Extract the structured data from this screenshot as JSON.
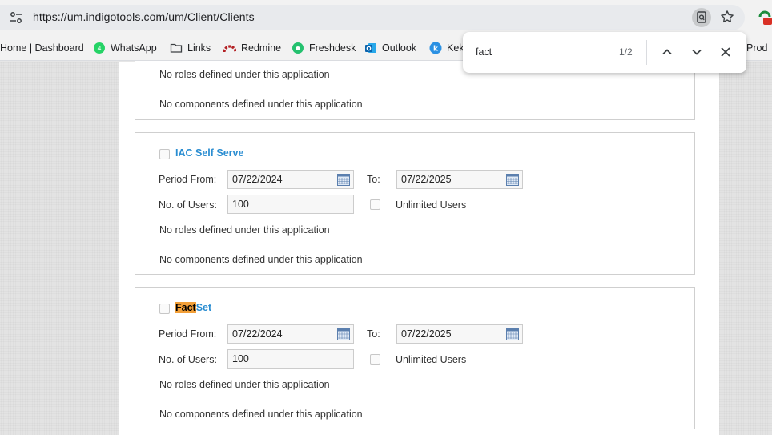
{
  "browser": {
    "url": "https://um.indigotools.com/um/Client/Clients",
    "bookmarks": [
      {
        "label": "Home | Dashboard"
      },
      {
        "label": "WhatsApp"
      },
      {
        "label": "Links"
      },
      {
        "label": "Redmine"
      },
      {
        "label": "Freshdesk"
      },
      {
        "label": "Outlook"
      },
      {
        "label": "Kek"
      },
      {
        "label": "Prod"
      }
    ]
  },
  "find": {
    "query": "fact",
    "count": "1/2"
  },
  "top_panel": {
    "roles_note": "No roles defined under this application",
    "components_note": "No components defined under this application"
  },
  "apps": [
    {
      "title": "IAC Self Serve",
      "period_from_label": "Period From:",
      "period_from": "07/22/2024",
      "to_label": "To:",
      "period_to": "07/22/2025",
      "users_label": "No. of Users:",
      "users": "100",
      "unlimited_label": "Unlimited Users",
      "roles_note": "No roles defined under this application",
      "components_note": "No components defined under this application"
    },
    {
      "title_highlight": "Fact",
      "title_rest": "Set",
      "period_from_label": "Period From:",
      "period_from": "07/22/2024",
      "to_label": "To:",
      "period_to": "07/22/2025",
      "users_label": "No. of Users:",
      "users": "100",
      "unlimited_label": "Unlimited Users",
      "roles_note": "No roles defined under this application",
      "components_note": "No components defined under this application"
    }
  ],
  "colors": {
    "link": "#2a8dd1",
    "find_highlight": "#f29f38"
  }
}
